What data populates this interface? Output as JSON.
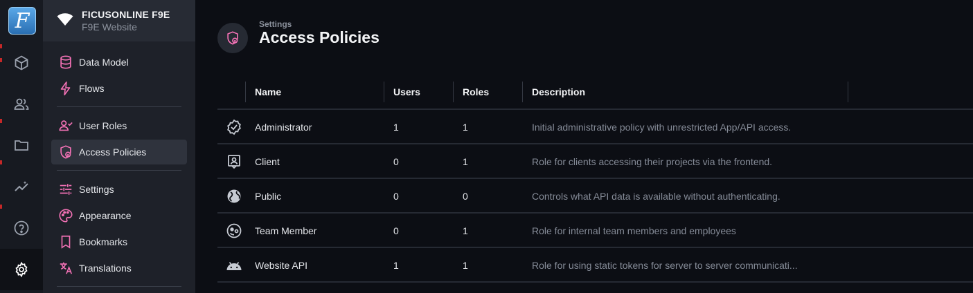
{
  "rail": {
    "logo_letter": "F",
    "items": [
      {
        "icon": "cube-icon"
      },
      {
        "icon": "users-icon"
      },
      {
        "icon": "folder-icon"
      },
      {
        "icon": "insights-icon"
      },
      {
        "icon": "help-icon"
      },
      {
        "icon": "gear-icon"
      }
    ]
  },
  "project": {
    "name": "FICUSONLINE F9E",
    "subtitle": "F9E Website"
  },
  "sidebar": {
    "items": [
      {
        "label": "Data Model",
        "icon": "database-icon"
      },
      {
        "label": "Flows",
        "icon": "bolt-icon"
      },
      {
        "label": "User Roles",
        "icon": "user-roles-icon"
      },
      {
        "label": "Access Policies",
        "icon": "shield-lock-icon",
        "active": true
      },
      {
        "label": "Settings",
        "icon": "tune-icon"
      },
      {
        "label": "Appearance",
        "icon": "palette-icon"
      },
      {
        "label": "Bookmarks",
        "icon": "bookmark-icon"
      },
      {
        "label": "Translations",
        "icon": "translate-icon"
      }
    ]
  },
  "header": {
    "breadcrumb": "Settings",
    "title": "Access Policies"
  },
  "table": {
    "columns": [
      "Name",
      "Users",
      "Roles",
      "Description"
    ],
    "rows": [
      {
        "icon": "verified-icon",
        "name": "Administrator",
        "users": "1",
        "roles": "1",
        "description": "Initial administrative policy with unrestricted App/API access."
      },
      {
        "icon": "badge-icon",
        "name": "Client",
        "users": "0",
        "roles": "1",
        "description": "Role for clients accessing their projects via the frontend."
      },
      {
        "icon": "globe-icon",
        "name": "Public",
        "users": "0",
        "roles": "0",
        "description": "Controls what API data is available without authenticating."
      },
      {
        "icon": "face-icon",
        "name": "Team Member",
        "users": "0",
        "roles": "1",
        "description": "Role for internal team members and employees"
      },
      {
        "icon": "android-icon",
        "name": "Website API",
        "users": "1",
        "roles": "1",
        "description": "Role for using static tokens for server to server communicati..."
      }
    ]
  },
  "colors": {
    "accent": "#f472b6",
    "background": "#0c0e14",
    "sidebar": "#1e2129",
    "rail": "#171a21"
  }
}
